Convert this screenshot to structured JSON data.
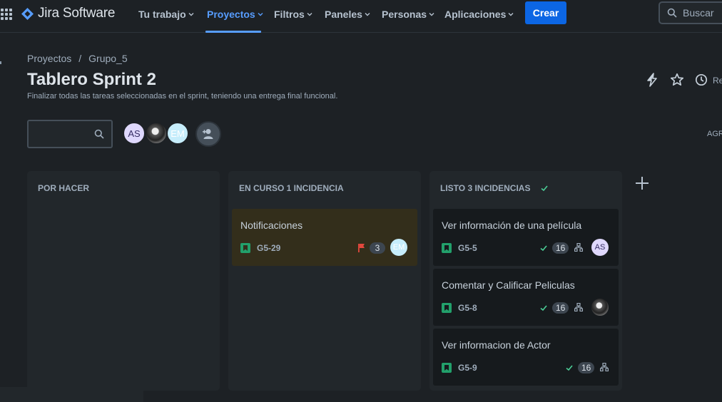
{
  "nav": {
    "logo_text": "Jira Software",
    "items": [
      {
        "label": "Tu trabajo"
      },
      {
        "label": "Proyectos"
      },
      {
        "label": "Filtros"
      },
      {
        "label": "Paneles"
      },
      {
        "label": "Personas"
      },
      {
        "label": "Aplicaciones"
      }
    ],
    "active_item": "Proyectos",
    "create_label": "Crear",
    "search_label": "Buscar",
    "accent_color": "#579dff"
  },
  "breadcrumb": {
    "items": [
      "Proyectos",
      "Grupo_5"
    ],
    "separator": "/"
  },
  "board": {
    "title": "Tablero Sprint 2",
    "subtitle": "Finalizar todas las tareas seleccionadas en el sprint, teniendo una entrega final funcional.",
    "header_right_partial": "Re",
    "filter_right_partial": "AGR"
  },
  "members": [
    {
      "initials": "AS"
    },
    {
      "initials": ""
    },
    {
      "initials": "EM"
    }
  ],
  "columns": [
    {
      "title": "POR HACER",
      "cards": []
    },
    {
      "title": "EN CURSO 1 INCIDENCIA",
      "cards": [
        {
          "title": "Notificaciones",
          "key": "G5-29",
          "flagged": true,
          "points": "3",
          "assignee": "EM"
        }
      ]
    },
    {
      "title": "LISTO 3 INCIDENCIAS",
      "done": true,
      "cards": [
        {
          "title": "Ver información de una película",
          "key": "G5-5",
          "points": "16",
          "assignee": "AS"
        },
        {
          "title": "Comentar y Calificar Peliculas",
          "key": "G5-8",
          "points": "16",
          "assignee": ""
        },
        {
          "title": "Ver informacion de Actor",
          "key": "G5-9",
          "points": "16",
          "assignee": ""
        }
      ]
    }
  ],
  "icons": [
    "apps-grid-icon",
    "jira-logo-icon",
    "chevron-down-icon",
    "search-icon",
    "lightning-icon",
    "star-icon",
    "clock-icon",
    "add-people-icon",
    "plus-icon",
    "story-icon",
    "flag-icon",
    "check-icon",
    "subtask-icon"
  ],
  "colors": {
    "create_button": "#0c66e4",
    "story": "#22a06b",
    "flag": "#e2483d",
    "done_check": "#4bce97",
    "flagged_card": "#332e1b"
  }
}
